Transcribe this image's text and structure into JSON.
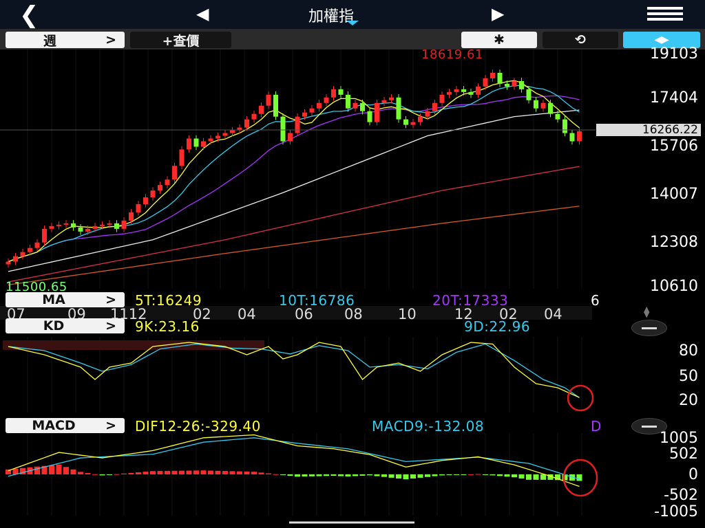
{
  "header": {
    "title": "加權指",
    "back_icon": "chevron-left-icon",
    "prev_icon": "triangle-left-icon",
    "next_icon": "triangle-right-icon",
    "menu_icon": "hamburger-menu-icon"
  },
  "toolbar": {
    "period_label": "週",
    "period_arrow": ">",
    "quote_label": "+查價",
    "settings_icon": "gear-icon",
    "rotate_icon": "rotate-icon",
    "expand_icon": "collapse-arrows-icon"
  },
  "main": {
    "high_label": "18619.61",
    "low_label": "11500.65",
    "current_price": "16266.22",
    "y_axis": [
      "19103",
      "17404",
      "15706",
      "14007",
      "12308",
      "10610"
    ],
    "y_range": [
      10610,
      19103
    ],
    "ma_indicator": {
      "name": "MA",
      "arrow": ">",
      "ma5": "5T:16249",
      "ma10": "10T:16786",
      "ma20": "20T:17333",
      "more": "6"
    },
    "dates": [
      "07",
      "09",
      "1112",
      "02",
      "04",
      "06",
      "08",
      "10",
      "12",
      "02",
      "04"
    ]
  },
  "kd": {
    "name": "KD",
    "arrow": ">",
    "k": "9K:23.16",
    "d": "9D:22.96",
    "y_axis": [
      "80",
      "50",
      "20"
    ]
  },
  "macd": {
    "name": "MACD",
    "arrow": ">",
    "dif": "DIF12-26:-329.40",
    "macd9": "MACD9:-132.08",
    "more": "D",
    "y_axis": [
      "1005",
      "502",
      "0",
      "-502",
      "-1005"
    ]
  },
  "colors": {
    "up": "#ff2a2a",
    "down": "#77ff33",
    "ma5": "#ffff33",
    "ma10": "#33ccee",
    "ma20": "#aa33ff",
    "accent": "#3cc8f5"
  },
  "chart_data": {
    "type": "candlestick",
    "closes": [
      11500,
      11700,
      11850,
      12000,
      12200,
      12700,
      12800,
      12850,
      12900,
      12750,
      12600,
      12700,
      12800,
      12850,
      12900,
      12700,
      13000,
      13300,
      13600,
      13850,
      14100,
      14300,
      14500,
      15000,
      15600,
      16000,
      15700,
      15900,
      16000,
      16100,
      16200,
      16300,
      16400,
      16700,
      16900,
      17200,
      17600,
      16800,
      15900,
      16200,
      16800,
      16950,
      17100,
      17300,
      17500,
      17800,
      17600,
      17100,
      17300,
      17000,
      16600,
      17300,
      17400,
      17500,
      16700,
      16500,
      16600,
      16800,
      17000,
      17300,
      17600,
      17700,
      17800,
      17700,
      17600,
      17900,
      18200,
      18400,
      18000,
      17900,
      18100,
      17800,
      17400,
      17100,
      17300,
      16900,
      16700,
      16200,
      15900,
      16266
    ],
    "long_ma_white": [
      [
        0,
        11140
      ],
      [
        20,
        12300
      ],
      [
        38,
        14020
      ],
      [
        58,
        16100
      ],
      [
        70,
        16800
      ],
      [
        79,
        17040
      ]
    ],
    "long_ma_red": [
      [
        0,
        10760
      ],
      [
        30,
        12300
      ],
      [
        60,
        14100
      ],
      [
        79,
        14980
      ]
    ],
    "long_ma_orange": [
      [
        0,
        10650
      ],
      [
        30,
        11800
      ],
      [
        60,
        12900
      ],
      [
        79,
        13530
      ]
    ],
    "k": [
      [
        0,
        85
      ],
      [
        5,
        75
      ],
      [
        10,
        60
      ],
      [
        12,
        45
      ],
      [
        14,
        60
      ],
      [
        17,
        65
      ],
      [
        20,
        85
      ],
      [
        25,
        90
      ],
      [
        30,
        85
      ],
      [
        33,
        75
      ],
      [
        36,
        85
      ],
      [
        38,
        70
      ],
      [
        40,
        75
      ],
      [
        43,
        90
      ],
      [
        46,
        85
      ],
      [
        49,
        45
      ],
      [
        51,
        60
      ],
      [
        54,
        65
      ],
      [
        57,
        55
      ],
      [
        60,
        75
      ],
      [
        64,
        90
      ],
      [
        67,
        88
      ],
      [
        70,
        60
      ],
      [
        73,
        40
      ],
      [
        76,
        35
      ],
      [
        79,
        23.16
      ]
    ],
    "d": [
      [
        0,
        85
      ],
      [
        5,
        80
      ],
      [
        10,
        65
      ],
      [
        13,
        55
      ],
      [
        17,
        63
      ],
      [
        21,
        82
      ],
      [
        26,
        88
      ],
      [
        31,
        83
      ],
      [
        35,
        82
      ],
      [
        39,
        76
      ],
      [
        43,
        86
      ],
      [
        47,
        80
      ],
      [
        50,
        60
      ],
      [
        54,
        63
      ],
      [
        58,
        58
      ],
      [
        62,
        78
      ],
      [
        66,
        88
      ],
      [
        70,
        68
      ],
      [
        74,
        45
      ],
      [
        77,
        35
      ],
      [
        79,
        22.96
      ]
    ],
    "dif": [
      [
        0,
        100
      ],
      [
        7,
        600
      ],
      [
        13,
        450
      ],
      [
        20,
        650
      ],
      [
        27,
        1000
      ],
      [
        34,
        1080
      ],
      [
        40,
        780
      ],
      [
        45,
        700
      ],
      [
        50,
        540
      ],
      [
        55,
        200
      ],
      [
        60,
        380
      ],
      [
        65,
        480
      ],
      [
        70,
        260
      ],
      [
        75,
        -50
      ],
      [
        79,
        -329.4
      ]
    ],
    "macd9": [
      [
        0,
        -50
      ],
      [
        10,
        450
      ],
      [
        20,
        550
      ],
      [
        27,
        880
      ],
      [
        34,
        1000
      ],
      [
        40,
        850
      ],
      [
        47,
        700
      ],
      [
        55,
        350
      ],
      [
        65,
        470
      ],
      [
        72,
        300
      ],
      [
        79,
        -132.08
      ]
    ]
  }
}
